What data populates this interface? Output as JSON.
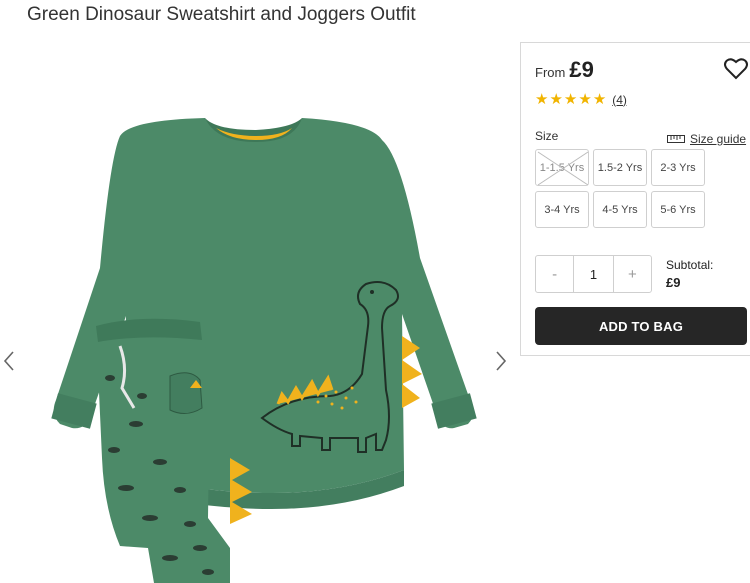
{
  "product": {
    "title": "Green Dinosaur Sweatshirt and Joggers Outfit"
  },
  "gallery": {
    "prev_icon": "chevron-left-icon",
    "next_icon": "chevron-right-icon"
  },
  "purchase": {
    "from_label": "From",
    "price": "£9",
    "wishlist_icon": "heart-icon",
    "rating_stars": 5,
    "reviews_count": "(4)",
    "size_label": "Size",
    "size_guide_label": "Size guide",
    "sizes": [
      {
        "label": "1-1.5 Yrs",
        "available": false
      },
      {
        "label": "1.5-2 Yrs",
        "available": true
      },
      {
        "label": "2-3 Yrs",
        "available": true
      },
      {
        "label": "3-4 Yrs",
        "available": true
      },
      {
        "label": "4-5 Yrs",
        "available": true
      },
      {
        "label": "5-6 Yrs",
        "available": true
      }
    ],
    "quantity": {
      "minus": "-",
      "value": "1",
      "plus": "+"
    },
    "subtotal_label": "Subtotal:",
    "subtotal_value": "£9",
    "add_to_bag": "ADD TO BAG"
  },
  "colors": {
    "sweatshirt_green": "#4c8a68",
    "dino_yellow": "#f0b21d",
    "star_yellow": "#f1b400",
    "button_dark": "#262626"
  }
}
